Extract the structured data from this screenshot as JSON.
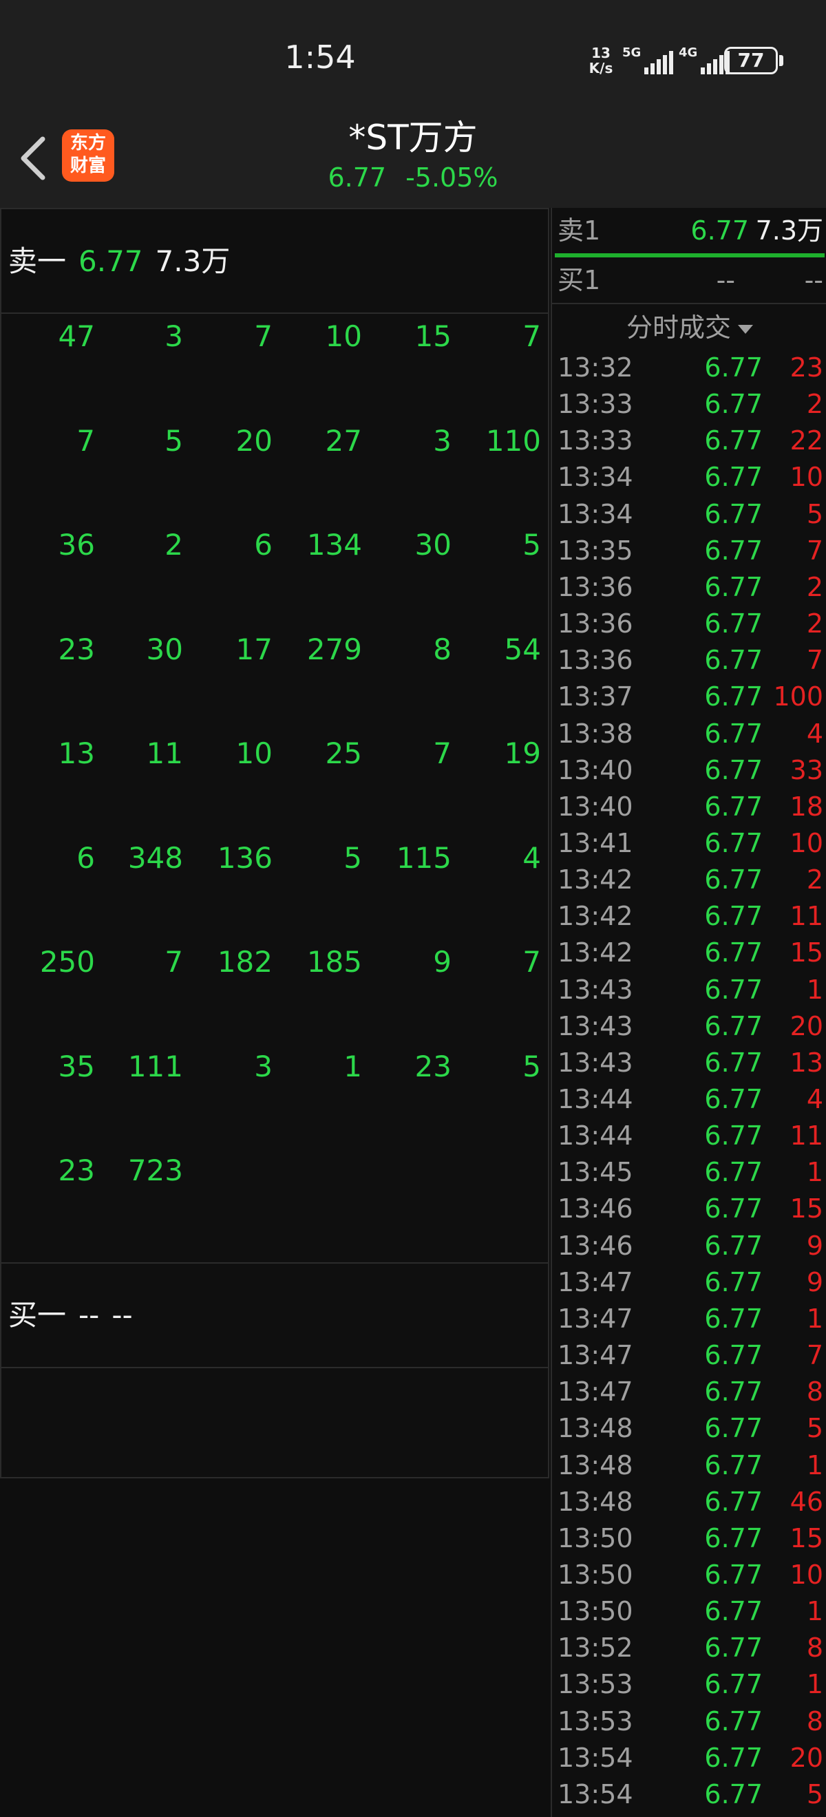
{
  "status_bar": {
    "time": "1:54",
    "net_speed_value": "13",
    "net_speed_unit": "K/s",
    "signal1_label": "5G",
    "signal2_label": "4G",
    "battery": "77"
  },
  "header": {
    "logo_line1": "东方",
    "logo_line2": "财富",
    "stock_name": "*ST万方",
    "price": "6.77",
    "change_pct": "-5.05%"
  },
  "queue": {
    "sell_label": "卖一",
    "sell_price": "6.77",
    "sell_volume": "7.3万",
    "rows": [
      [
        "47",
        "3",
        "7",
        "10",
        "15",
        "7"
      ],
      [
        "7",
        "5",
        "20",
        "27",
        "3",
        "110"
      ],
      [
        "36",
        "2",
        "6",
        "134",
        "30",
        "5"
      ],
      [
        "23",
        "30",
        "17",
        "279",
        "8",
        "54"
      ],
      [
        "13",
        "11",
        "10",
        "25",
        "7",
        "19"
      ],
      [
        "6",
        "348",
        "136",
        "5",
        "115",
        "4"
      ],
      [
        "250",
        "7",
        "182",
        "185",
        "9",
        "7"
      ],
      [
        "35",
        "111",
        "3",
        "1",
        "23",
        "5"
      ],
      [
        "23",
        "723"
      ]
    ],
    "buy_label": "买一",
    "buy_price": "--",
    "buy_volume": "--"
  },
  "levels": {
    "sell1_label": "卖1",
    "sell1_price": "6.77",
    "sell1_volume": "7.3万",
    "buy1_label": "买1",
    "buy1_price": "--",
    "buy1_volume": "--"
  },
  "ticks_header": "分时成交",
  "ticks": [
    {
      "time": "13:32",
      "price": "6.77",
      "volume": "23"
    },
    {
      "time": "13:33",
      "price": "6.77",
      "volume": "2"
    },
    {
      "time": "13:33",
      "price": "6.77",
      "volume": "22"
    },
    {
      "time": "13:34",
      "price": "6.77",
      "volume": "10"
    },
    {
      "time": "13:34",
      "price": "6.77",
      "volume": "5"
    },
    {
      "time": "13:35",
      "price": "6.77",
      "volume": "7"
    },
    {
      "time": "13:36",
      "price": "6.77",
      "volume": "2"
    },
    {
      "time": "13:36",
      "price": "6.77",
      "volume": "2"
    },
    {
      "time": "13:36",
      "price": "6.77",
      "volume": "7"
    },
    {
      "time": "13:37",
      "price": "6.77",
      "volume": "100"
    },
    {
      "time": "13:38",
      "price": "6.77",
      "volume": "4"
    },
    {
      "time": "13:40",
      "price": "6.77",
      "volume": "33"
    },
    {
      "time": "13:40",
      "price": "6.77",
      "volume": "18"
    },
    {
      "time": "13:41",
      "price": "6.77",
      "volume": "10"
    },
    {
      "time": "13:42",
      "price": "6.77",
      "volume": "2"
    },
    {
      "time": "13:42",
      "price": "6.77",
      "volume": "11"
    },
    {
      "time": "13:42",
      "price": "6.77",
      "volume": "15"
    },
    {
      "time": "13:43",
      "price": "6.77",
      "volume": "1"
    },
    {
      "time": "13:43",
      "price": "6.77",
      "volume": "20"
    },
    {
      "time": "13:43",
      "price": "6.77",
      "volume": "13"
    },
    {
      "time": "13:44",
      "price": "6.77",
      "volume": "4"
    },
    {
      "time": "13:44",
      "price": "6.77",
      "volume": "11"
    },
    {
      "time": "13:45",
      "price": "6.77",
      "volume": "1"
    },
    {
      "time": "13:46",
      "price": "6.77",
      "volume": "15"
    },
    {
      "time": "13:46",
      "price": "6.77",
      "volume": "9"
    },
    {
      "time": "13:47",
      "price": "6.77",
      "volume": "9"
    },
    {
      "time": "13:47",
      "price": "6.77",
      "volume": "1"
    },
    {
      "time": "13:47",
      "price": "6.77",
      "volume": "7"
    },
    {
      "time": "13:47",
      "price": "6.77",
      "volume": "8"
    },
    {
      "time": "13:48",
      "price": "6.77",
      "volume": "5"
    },
    {
      "time": "13:48",
      "price": "6.77",
      "volume": "1"
    },
    {
      "time": "13:48",
      "price": "6.77",
      "volume": "46"
    },
    {
      "time": "13:50",
      "price": "6.77",
      "volume": "15"
    },
    {
      "time": "13:50",
      "price": "6.77",
      "volume": "10"
    },
    {
      "time": "13:50",
      "price": "6.77",
      "volume": "1"
    },
    {
      "time": "13:52",
      "price": "6.77",
      "volume": "8"
    },
    {
      "time": "13:53",
      "price": "6.77",
      "volume": "1"
    },
    {
      "time": "13:53",
      "price": "6.77",
      "volume": "8"
    },
    {
      "time": "13:54",
      "price": "6.77",
      "volume": "20"
    },
    {
      "time": "13:54",
      "price": "6.77",
      "volume": "5"
    }
  ],
  "colors": {
    "background": "#0e0e0e",
    "header_bg": "#1f1f1f",
    "down_green": "#2cd84a",
    "up_red": "#e52222",
    "logo_orange": "#ff5a1f"
  }
}
